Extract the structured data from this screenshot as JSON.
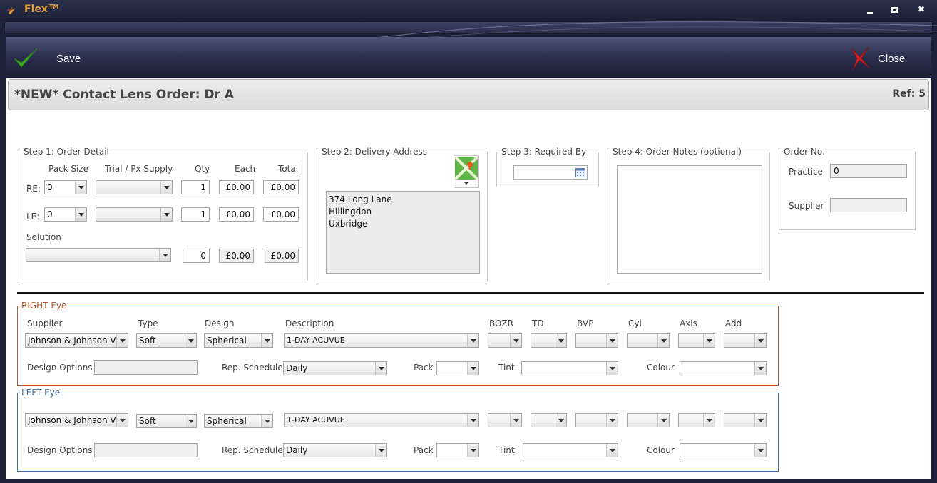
{
  "app": {
    "title": "Flex",
    "trademark": "TM"
  },
  "window_controls": {
    "minimize": "minimize",
    "maximize": "maximize",
    "close": "✖"
  },
  "toolbar": {
    "save_label": "Save",
    "close_label": "Close"
  },
  "header": {
    "title": "*NEW* Contact Lens Order: Dr  A",
    "ref": "Ref: 5"
  },
  "step1": {
    "legend": "Step 1: Order Detail",
    "col_pack_size": "Pack Size",
    "col_trial": "Trial / Px Supply",
    "col_qty": "Qty",
    "col_each": "Each",
    "col_total": "Total",
    "re_label": "RE:",
    "le_label": "LE:",
    "solution_label": "Solution",
    "re": {
      "pack_size": "0",
      "trial": "",
      "qty": "1",
      "each": "£0.00",
      "total": "£0.00"
    },
    "le": {
      "pack_size": "0",
      "trial": "",
      "qty": "1",
      "each": "£0.00",
      "total": "£0.00"
    },
    "solution": {
      "product": "",
      "qty": "0",
      "each": "£0.00",
      "total": "£0.00"
    }
  },
  "step2": {
    "legend": "Step 2: Delivery Address",
    "address_lines": [
      "374 Long Lane",
      "Hillingdon",
      "Uxbridge"
    ]
  },
  "step3": {
    "legend": "Step 3: Required By",
    "date": ""
  },
  "step4": {
    "legend": "Step 4: Order Notes (optional)",
    "notes": ""
  },
  "order_no": {
    "legend": "Order No.",
    "practice_label": "Practice",
    "practice_value": "0",
    "supplier_label": "Supplier",
    "supplier_value": ""
  },
  "right_eye": {
    "legend": "RIGHT Eye",
    "headers": {
      "supplier": "Supplier",
      "type": "Type",
      "design": "Design",
      "description": "Description",
      "bozr": "BOZR",
      "td": "TD",
      "bvp": "BVP",
      "cyl": "Cyl",
      "axis": "Axis",
      "add": "Add"
    },
    "supplier": "Johnson & Johnson V",
    "type": "Soft",
    "design": "Spherical",
    "description": "1-DAY ACUVUE",
    "design_options_label": "Design Options",
    "rep_schedule_label": "Rep. Schedule",
    "rep_schedule": "Daily",
    "pack_label": "Pack",
    "tint_label": "Tint",
    "colour_label": "Colour"
  },
  "left_eye": {
    "legend": "LEFT Eye",
    "supplier": "Johnson & Johnson V",
    "type": "Soft",
    "design": "Spherical",
    "description": "1-DAY ACUVUE",
    "design_options_label": "Design Options",
    "rep_schedule_label": "Rep. Schedule",
    "rep_schedule": "Daily",
    "pack_label": "Pack",
    "tint_label": "Tint",
    "colour_label": "Colour"
  },
  "colors": {
    "title_orange": "#e8a13a",
    "right_eye": "#b5552e",
    "left_eye": "#3e6fa8",
    "save_green": "#3fae2a",
    "close_red": "#d42020"
  }
}
